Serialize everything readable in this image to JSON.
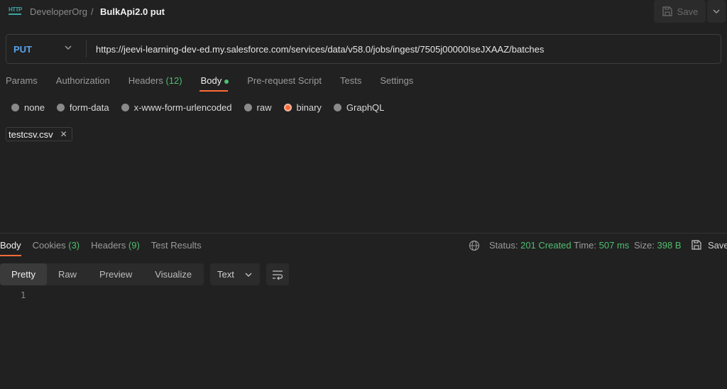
{
  "header": {
    "icon_text": "HTTP",
    "breadcrumb_parent": "DeveloperOrg",
    "breadcrumb_separator": "/",
    "request_name": "BulkApi2.0 put",
    "save_label": "Save"
  },
  "request": {
    "method": "PUT",
    "url": "https://jeevi-learning-dev-ed.my.salesforce.com/services/data/v58.0/jobs/ingest/7505j00000IseJXAAZ/batches"
  },
  "request_tabs": {
    "params": "Params",
    "authorization": "Authorization",
    "headers": "Headers",
    "headers_count": "(12)",
    "body": "Body",
    "prerequest": "Pre-request Script",
    "tests": "Tests",
    "settings": "Settings"
  },
  "body_modes": {
    "none": "none",
    "form_data": "form-data",
    "urlencoded": "x-www-form-urlencoded",
    "raw": "raw",
    "binary": "binary",
    "graphql": "GraphQL",
    "selected": "binary"
  },
  "file": {
    "name": "testcsv.csv",
    "remove_glyph": "✕"
  },
  "response_tabs": {
    "body": "Body",
    "cookies": "Cookies",
    "cookies_count": "(3)",
    "headers": "Headers",
    "headers_count": "(9)",
    "test_results": "Test Results"
  },
  "response_meta": {
    "status_label": "Status:",
    "status_value": "201 Created",
    "time_label": "Time:",
    "time_value": "507 ms",
    "size_label": "Size:",
    "size_value": "398 B",
    "save_label": "Save"
  },
  "response_view": {
    "pretty": "Pretty",
    "raw": "Raw",
    "preview": "Preview",
    "visualize": "Visualize",
    "format": "Text",
    "line_number": "1"
  },
  "colors": {
    "background": "#212121",
    "accent": "#ff6c37",
    "success": "#4fbf6e",
    "method": "#5aa2e8"
  }
}
